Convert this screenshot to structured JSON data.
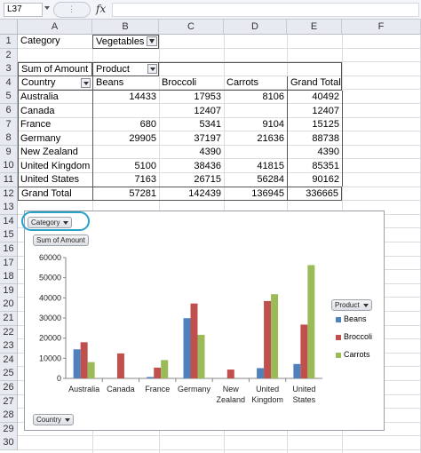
{
  "formula_bar": {
    "name_box": "L37",
    "fx": "fx",
    "formula": ""
  },
  "columns": [
    "A",
    "B",
    "C",
    "D",
    "E",
    "F"
  ],
  "rows": [
    "1",
    "2",
    "3",
    "4",
    "5",
    "6",
    "7",
    "8",
    "9",
    "10",
    "11",
    "12",
    "13",
    "14",
    "15",
    "16",
    "17",
    "18",
    "19",
    "20",
    "21",
    "22",
    "23",
    "24",
    "25",
    "26",
    "27",
    "28",
    "29",
    "30"
  ],
  "pivot": {
    "filter_label": "Category",
    "filter_value": "Vegetables",
    "values_label": "Sum of Amount",
    "columns_label": "Product",
    "rows_label": "Country",
    "column_headers": [
      "Beans",
      "Broccoli",
      "Carrots",
      "Grand Total"
    ],
    "rows": [
      {
        "country": "Australia",
        "beans": "14433",
        "broccoli": "17953",
        "carrots": "8106",
        "total": "40492"
      },
      {
        "country": "Canada",
        "beans": "",
        "broccoli": "12407",
        "carrots": "",
        "total": "12407"
      },
      {
        "country": "France",
        "beans": "680",
        "broccoli": "5341",
        "carrots": "9104",
        "total": "15125"
      },
      {
        "country": "Germany",
        "beans": "29905",
        "broccoli": "37197",
        "carrots": "21636",
        "total": "88738"
      },
      {
        "country": "New Zealand",
        "beans": "",
        "broccoli": "4390",
        "carrots": "",
        "total": "4390"
      },
      {
        "country": "United Kingdom",
        "beans": "5100",
        "broccoli": "38436",
        "carrots": "41815",
        "total": "85351"
      },
      {
        "country": "United States",
        "beans": "7163",
        "broccoli": "26715",
        "carrots": "56284",
        "total": "90162"
      }
    ],
    "grand_total": {
      "label": "Grand Total",
      "beans": "57281",
      "broccoli": "142439",
      "carrots": "136945",
      "total": "336665"
    }
  },
  "chart_buttons": {
    "category": "Category",
    "sum": "Sum of Amount",
    "product": "Product",
    "country": "Country"
  },
  "chart_data": {
    "type": "bar",
    "categories": [
      "Australia",
      "Canada",
      "France",
      "Germany",
      "New Zealand",
      "United Kingdom",
      "United States"
    ],
    "category_lines": [
      [
        "Australia"
      ],
      [
        "Canada"
      ],
      [
        "France"
      ],
      [
        "Germany"
      ],
      [
        "New",
        "Zealand"
      ],
      [
        "United",
        "Kingdom"
      ],
      [
        "United",
        "States"
      ]
    ],
    "series": [
      {
        "name": "Beans",
        "color": "#4f81bd",
        "values": [
          14433,
          0,
          680,
          29905,
          0,
          5100,
          7163
        ]
      },
      {
        "name": "Broccoli",
        "color": "#c0504d",
        "values": [
          17953,
          12407,
          5341,
          37197,
          4390,
          38436,
          26715
        ]
      },
      {
        "name": "Carrots",
        "color": "#9bbb59",
        "values": [
          8106,
          0,
          9104,
          21636,
          0,
          41815,
          56284
        ]
      }
    ],
    "ylim": [
      0,
      60000
    ],
    "yticks": [
      "0",
      "10000",
      "20000",
      "30000",
      "40000",
      "50000",
      "60000"
    ],
    "legend_position": "right",
    "grid": false
  }
}
